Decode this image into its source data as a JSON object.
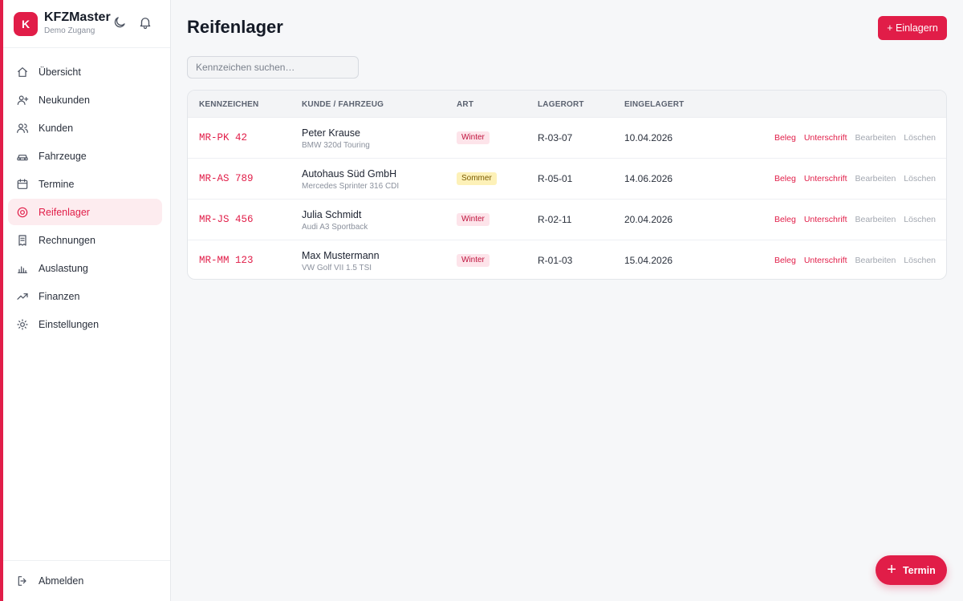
{
  "brand": {
    "logo_letter": "K",
    "name": "KFZMaster",
    "subtitle": "Demo Zugang"
  },
  "icons": {
    "theme": "moon-icon",
    "notifications": "bell-icon"
  },
  "sidebar": {
    "items": [
      {
        "label": "Übersicht",
        "icon": "home-icon",
        "active": false
      },
      {
        "label": "Neukunden",
        "icon": "user-plus-icon",
        "active": false
      },
      {
        "label": "Kunden",
        "icon": "users-icon",
        "active": false
      },
      {
        "label": "Fahrzeuge",
        "icon": "car-icon",
        "active": false
      },
      {
        "label": "Termine",
        "icon": "calendar-icon",
        "active": false
      },
      {
        "label": "Reifenlager",
        "icon": "target-icon",
        "active": true
      },
      {
        "label": "Rechnungen",
        "icon": "receipt-icon",
        "active": false
      },
      {
        "label": "Auslastung",
        "icon": "bar-chart-icon",
        "active": false
      },
      {
        "label": "Finanzen",
        "icon": "trending-up-icon",
        "active": false
      },
      {
        "label": "Einstellungen",
        "icon": "sun-gear-icon",
        "active": false
      }
    ],
    "logout_label": "Abmelden"
  },
  "page": {
    "title": "Reifenlager",
    "add_button": "+ Einlagern"
  },
  "search": {
    "placeholder": "Kennzeichen suchen…"
  },
  "table": {
    "headers": [
      "KENNZEICHEN",
      "KUNDE / FAHRZEUG",
      "ART",
      "LAGERORT",
      "EINGELAGERT"
    ],
    "rows": [
      {
        "plate": "MR-PK 42",
        "customer": "Peter Krause",
        "vehicle": "BMW 320d Touring",
        "type": "Winter",
        "location": "R-03-07",
        "stored": "10.04.2026"
      },
      {
        "plate": "MR-AS 789",
        "customer": "Autohaus Süd GmbH",
        "vehicle": "Mercedes Sprinter 316 CDI",
        "type": "Sommer",
        "location": "R-05-01",
        "stored": "14.06.2026"
      },
      {
        "plate": "MR-JS 456",
        "customer": "Julia Schmidt",
        "vehicle": "Audi A3 Sportback",
        "type": "Winter",
        "location": "R-02-11",
        "stored": "20.04.2026"
      },
      {
        "plate": "MR-MM 123",
        "customer": "Max Mustermann",
        "vehicle": "VW Golf VII 1.5 TSI",
        "type": "Winter",
        "location": "R-01-03",
        "stored": "15.04.2026"
      }
    ],
    "actions": {
      "receipt": "Beleg",
      "signature": "Unterschrift",
      "edit": "Bearbeiten",
      "delete": "Löschen"
    }
  },
  "fab": {
    "label": "Termin",
    "icon": "plus-icon"
  },
  "colors": {
    "accent": "#e11d48",
    "winter_badge": "#fde4ea",
    "summer_badge": "#fdf1b8"
  }
}
